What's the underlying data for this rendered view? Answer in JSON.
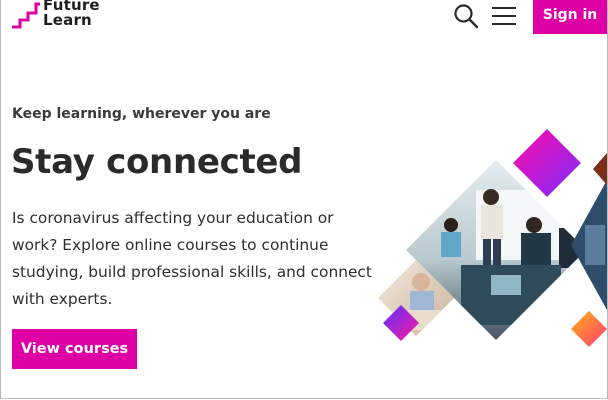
{
  "header": {
    "logo_line1": "Future",
    "logo_line2": "Learn",
    "search_icon": "search-icon",
    "menu_icon": "hamburger-menu-icon",
    "signin_label": "Sign in"
  },
  "hero": {
    "eyebrow": "Keep learning, wherever you are",
    "title": "Stay connected",
    "body": "Is coronavirus affecting your education or work? Explore online courses to continue studying, build professional skills, and connect with experts.",
    "cta_label": "View courses"
  },
  "colors": {
    "brand": "#de00a5",
    "brand_gradient_start": "#ff0aa8",
    "brand_gradient_end": "#7b2dff",
    "text": "#2a2a2a"
  }
}
